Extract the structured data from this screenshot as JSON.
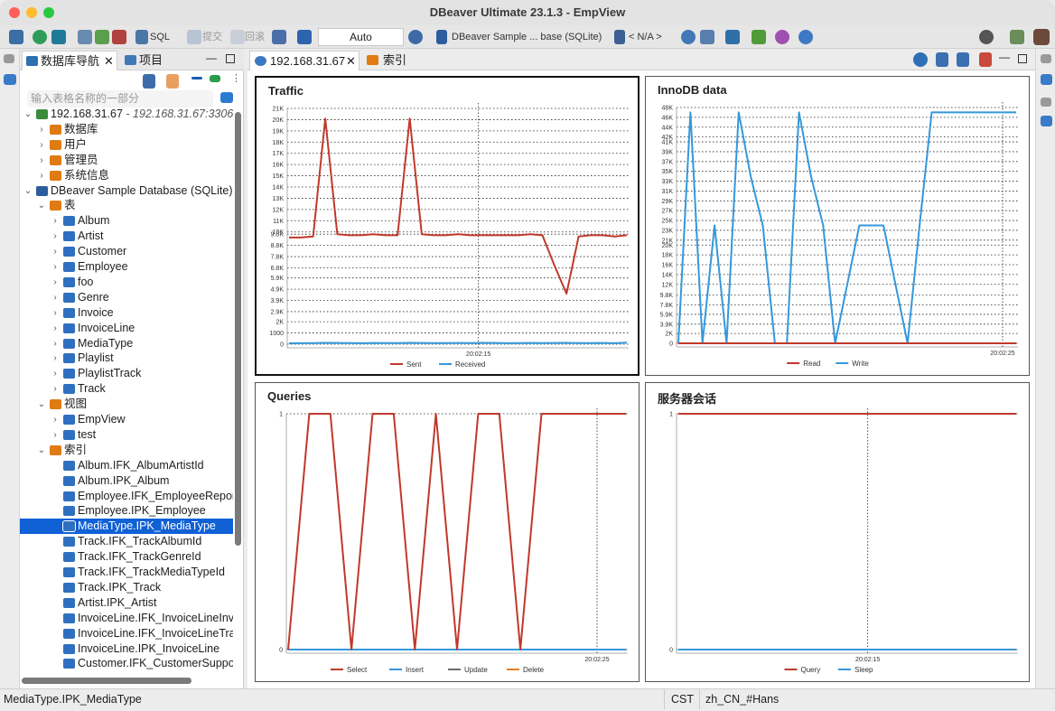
{
  "window": {
    "title": "DBeaver Ultimate 23.1.3 - EmpView"
  },
  "toolbar": {
    "sql_label": "SQL",
    "commit_label": "提交",
    "rollback_label": "回滚",
    "auto_label": "Auto",
    "datasource_label": "DBeaver Sample ... base (SQLite)",
    "schema_label": "< N/A >"
  },
  "nav": {
    "tab_navigator": "数据库导航",
    "tab_project": "项目",
    "filter_placeholder": "输入表格名称的一部分",
    "tree": [
      {
        "label": "192.168.31.67",
        "sub": " - 192.168.31.67:3306",
        "level": 0,
        "arrow": "open",
        "icon": "server"
      },
      {
        "label": "数据库",
        "level": 1,
        "arrow": "closed",
        "icon": "folder-db"
      },
      {
        "label": "用户",
        "level": 1,
        "arrow": "closed",
        "icon": "folder-user"
      },
      {
        "label": "管理员",
        "level": 1,
        "arrow": "closed",
        "icon": "folder-admin"
      },
      {
        "label": "系统信息",
        "level": 1,
        "arrow": "closed",
        "icon": "folder-info"
      },
      {
        "label": "DBeaver Sample Database (SQLite)",
        "level": 0,
        "arrow": "open",
        "icon": "sqlite"
      },
      {
        "label": "表",
        "level": 1,
        "arrow": "open",
        "icon": "folder-table"
      },
      {
        "label": "Album",
        "level": 2,
        "arrow": "closed",
        "icon": "table"
      },
      {
        "label": "Artist",
        "level": 2,
        "arrow": "closed",
        "icon": "table"
      },
      {
        "label": "Customer",
        "level": 2,
        "arrow": "closed",
        "icon": "table"
      },
      {
        "label": "Employee",
        "level": 2,
        "arrow": "closed",
        "icon": "table"
      },
      {
        "label": "foo",
        "level": 2,
        "arrow": "closed",
        "icon": "table"
      },
      {
        "label": "Genre",
        "level": 2,
        "arrow": "closed",
        "icon": "table"
      },
      {
        "label": "Invoice",
        "level": 2,
        "arrow": "closed",
        "icon": "table"
      },
      {
        "label": "InvoiceLine",
        "level": 2,
        "arrow": "closed",
        "icon": "table"
      },
      {
        "label": "MediaType",
        "level": 2,
        "arrow": "closed",
        "icon": "table"
      },
      {
        "label": "Playlist",
        "level": 2,
        "arrow": "closed",
        "icon": "table"
      },
      {
        "label": "PlaylistTrack",
        "level": 2,
        "arrow": "closed",
        "icon": "table"
      },
      {
        "label": "Track",
        "level": 2,
        "arrow": "closed",
        "icon": "table"
      },
      {
        "label": "视图",
        "level": 1,
        "arrow": "open",
        "icon": "folder-view"
      },
      {
        "label": "EmpView",
        "level": 2,
        "arrow": "closed",
        "icon": "view"
      },
      {
        "label": "test",
        "level": 2,
        "arrow": "closed",
        "icon": "view"
      },
      {
        "label": "索引",
        "level": 1,
        "arrow": "open",
        "icon": "folder-index"
      },
      {
        "label": "Album.IFK_AlbumArtistId",
        "level": 2,
        "arrow": "none",
        "icon": "index"
      },
      {
        "label": "Album.IPK_Album",
        "level": 2,
        "arrow": "none",
        "icon": "index"
      },
      {
        "label": "Employee.IFK_EmployeeReportsTo",
        "level": 2,
        "arrow": "none",
        "icon": "index"
      },
      {
        "label": "Employee.IPK_Employee",
        "level": 2,
        "arrow": "none",
        "icon": "index"
      },
      {
        "label": "MediaType.IPK_MediaType",
        "level": 2,
        "arrow": "none",
        "icon": "index",
        "selected": true
      },
      {
        "label": "Track.IFK_TrackAlbumId",
        "level": 2,
        "arrow": "none",
        "icon": "index"
      },
      {
        "label": "Track.IFK_TrackGenreId",
        "level": 2,
        "arrow": "none",
        "icon": "index"
      },
      {
        "label": "Track.IFK_TrackMediaTypeId",
        "level": 2,
        "arrow": "none",
        "icon": "index"
      },
      {
        "label": "Track.IPK_Track",
        "level": 2,
        "arrow": "none",
        "icon": "index"
      },
      {
        "label": "Artist.IPK_Artist",
        "level": 2,
        "arrow": "none",
        "icon": "index"
      },
      {
        "label": "InvoiceLine.IFK_InvoiceLineInvoiceId",
        "level": 2,
        "arrow": "none",
        "icon": "index"
      },
      {
        "label": "InvoiceLine.IFK_InvoiceLineTrackId",
        "level": 2,
        "arrow": "none",
        "icon": "index"
      },
      {
        "label": "InvoiceLine.IPK_InvoiceLine",
        "level": 2,
        "arrow": "none",
        "icon": "index"
      },
      {
        "label": "Customer.IFK_CustomerSupportRepId",
        "level": 2,
        "arrow": "none",
        "icon": "index"
      }
    ]
  },
  "editor": {
    "tab_server": "192.168.31.67",
    "tab_index": "索引"
  },
  "chart_data": [
    {
      "type": "line",
      "title": "Traffic",
      "yticks": [
        "0",
        "1000",
        "2K",
        "2.9K",
        "3.9K",
        "4.9K",
        "5.9K",
        "6.8K",
        "7.8K",
        "8.8K",
        "9.8K",
        "10K",
        "11K",
        "12K",
        "13K",
        "14K",
        "15K",
        "16K",
        "17K",
        "18K",
        "19K",
        "20K",
        "21K"
      ],
      "xtick": "20:02:15",
      "series": [
        {
          "name": "Sent",
          "color": "#c0392b",
          "values": [
            9500,
            9500,
            9600,
            20100,
            9800,
            9700,
            9700,
            9800,
            9700,
            9700,
            20100,
            9800,
            9700,
            9700,
            9800,
            9700,
            9700,
            9700,
            9700,
            9700,
            9800,
            9700,
            7000,
            4500,
            9600,
            9700,
            9700,
            9600,
            9700
          ]
        },
        {
          "name": "Received",
          "color": "#3498db",
          "values": [
            80,
            90,
            100,
            120,
            110,
            100,
            90,
            110,
            100,
            100,
            120,
            110,
            100,
            100,
            110,
            100,
            120,
            110,
            90,
            100,
            110,
            100,
            110,
            120,
            100,
            100,
            110,
            90,
            140
          ]
        }
      ]
    },
    {
      "type": "line",
      "title": "InnoDB data",
      "yticks": [
        "0",
        "2K",
        "3.9K",
        "5.9K",
        "7.8K",
        "9.8K",
        "12K",
        "14K",
        "16K",
        "18K",
        "20K",
        "21K",
        "23K",
        "25K",
        "27K",
        "29K",
        "31K",
        "33K",
        "35K",
        "37K",
        "39K",
        "41K",
        "42K",
        "44K",
        "46K",
        "48K"
      ],
      "xtick": "20:02:25",
      "series": [
        {
          "name": "Read",
          "color": "#c0392b",
          "values": [
            0,
            0,
            0,
            0,
            0,
            0,
            0,
            0,
            0,
            0,
            0,
            0,
            0,
            0,
            0,
            0,
            0,
            0,
            0,
            0,
            0,
            0,
            0,
            0,
            0,
            0,
            0,
            0,
            0
          ]
        },
        {
          "name": "Write",
          "color": "#3498db",
          "values": [
            0,
            47000,
            0,
            24000,
            0,
            47000,
            34000,
            24000,
            0,
            0,
            47000,
            34000,
            24000,
            0,
            12000,
            24000,
            24000,
            24000,
            12000,
            0,
            24000,
            47000,
            47000,
            47000,
            47000,
            47000,
            47000,
            47000,
            47000
          ]
        }
      ]
    },
    {
      "type": "line",
      "title": "Queries",
      "yticks": [
        "0",
        "1"
      ],
      "xtick": "20:02:25",
      "series": [
        {
          "name": "Select",
          "color": "#c0392b",
          "values": [
            0,
            1,
            1,
            0,
            1,
            1,
            0,
            1,
            0,
            1,
            1,
            0,
            1,
            1,
            1,
            1,
            1
          ]
        },
        {
          "name": "Insert",
          "color": "#3498db",
          "values": [
            0,
            0,
            0,
            0,
            0,
            0,
            0,
            0,
            0,
            0,
            0,
            0,
            0,
            0,
            0,
            0,
            0
          ]
        },
        {
          "name": "Update",
          "color": "#6d6d6d",
          "values": [
            0,
            0,
            0,
            0,
            0,
            0,
            0,
            0,
            0,
            0,
            0,
            0,
            0,
            0,
            0,
            0,
            0
          ]
        },
        {
          "name": "Delete",
          "color": "#e67e22",
          "values": [
            0,
            0,
            0,
            0,
            0,
            0,
            0,
            0,
            0,
            0,
            0,
            0,
            0,
            0,
            0,
            0,
            0
          ]
        }
      ]
    },
    {
      "type": "line",
      "title": "服务器会话",
      "yticks": [
        "0",
        "1"
      ],
      "xtick": "20:02:15",
      "series": [
        {
          "name": "Query",
          "color": "#c0392b",
          "values": [
            1,
            1,
            1,
            1,
            1,
            1,
            1,
            1,
            1,
            1
          ]
        },
        {
          "name": "Sleep",
          "color": "#3498db",
          "values": [
            0,
            0,
            0,
            0,
            0,
            0,
            0,
            0,
            0,
            0
          ]
        }
      ]
    }
  ],
  "status": {
    "selection": "MediaType.IPK_MediaType",
    "timezone": "CST",
    "locale": "zh_CN_#Hans"
  }
}
